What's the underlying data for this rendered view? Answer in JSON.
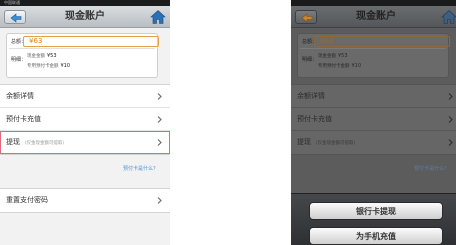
{
  "left": {
    "status": {
      "carrier": "中国联通"
    },
    "nav": {
      "title": "现金账户"
    },
    "summary": {
      "total_label": "总额：",
      "total_value": "¥63",
      "detail_label": "明细：",
      "cash_label": "现金金额",
      "cash_value": "¥53",
      "prepaid_label": "专用预付卡金额",
      "prepaid_value": "¥10"
    },
    "menu": [
      {
        "label": "余额详情"
      },
      {
        "label": "预付卡充值"
      },
      {
        "label": "提现",
        "hint": "（仅金现金额可提取）"
      }
    ],
    "link": "预付卡是什么？",
    "password_item": {
      "label": "重置支付密码"
    }
  },
  "right": {
    "nav": {
      "title": "现金账户"
    },
    "summary": {
      "total_label": "总额：",
      "total_value": "¥63",
      "detail_label": "明细：",
      "cash_label": "现金金额",
      "cash_value": "¥53",
      "prepaid_label": "专用预付卡金额",
      "prepaid_value": "¥10"
    },
    "menu": [
      {
        "label": "余额详情"
      },
      {
        "label": "预付卡充值"
      },
      {
        "label": "提现",
        "hint": "（仅金现金额可提取）"
      }
    ],
    "link": "预付卡是什么？",
    "sheet": {
      "bank_withdraw": "银行卡提现",
      "phone_recharge": "为手机充值"
    }
  },
  "colors": {
    "amount": "#e8820c",
    "link": "#4a8fd6",
    "highlight_border": "#e06a7a",
    "home_icon": "#2a6fb8"
  },
  "icons": [
    "back-arrow-icon",
    "home-icon",
    "chevron-right-icon"
  ]
}
